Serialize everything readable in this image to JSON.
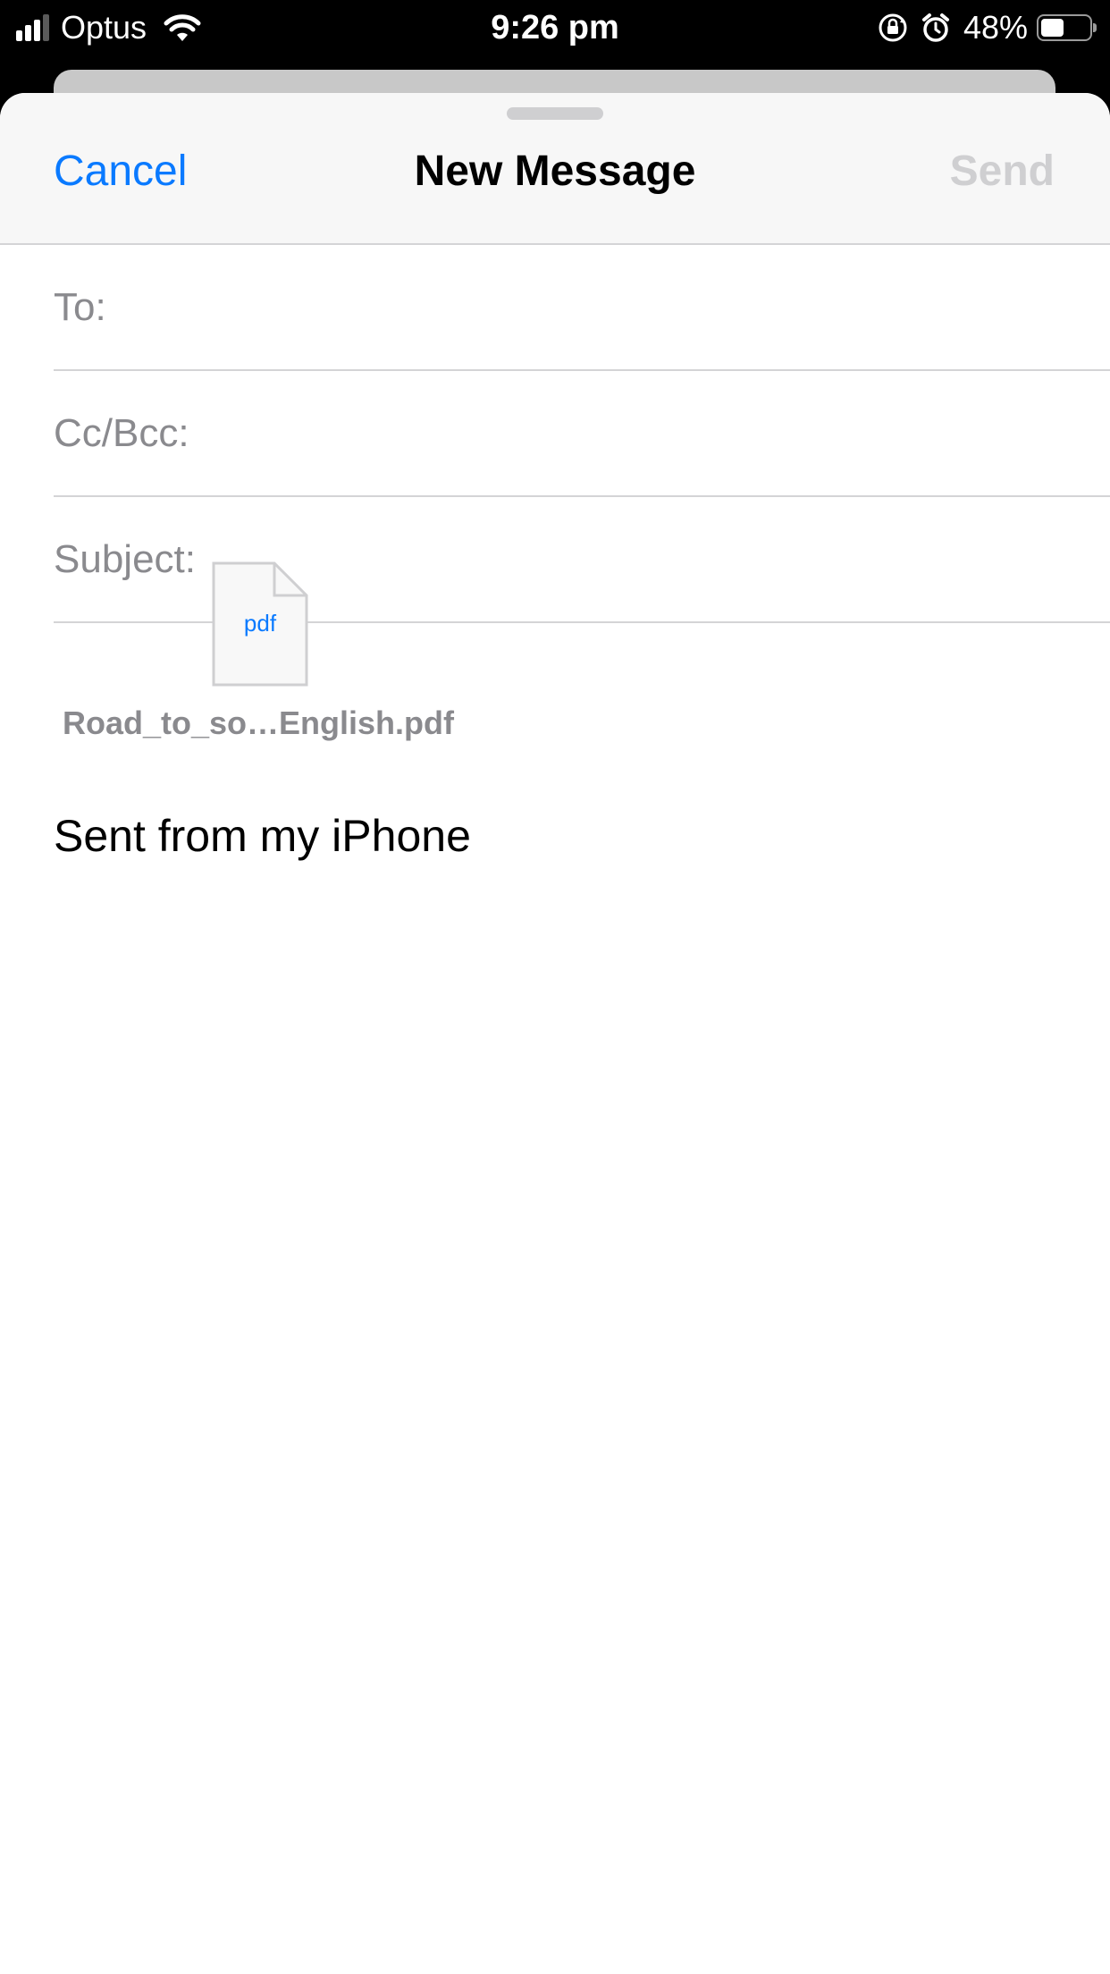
{
  "status_bar": {
    "carrier": "Optus",
    "time": "9:26 pm",
    "battery_percent_text": "48%",
    "battery_level": 0.48,
    "signal_bars_filled": 3,
    "signal_bars_total": 4,
    "icons": [
      "signal-icon",
      "wifi-icon",
      "rotation-lock-icon",
      "alarm-icon",
      "battery-icon"
    ]
  },
  "nav": {
    "cancel_label": "Cancel",
    "title": "New Message",
    "send_label": "Send"
  },
  "fields": {
    "to_label": "To:",
    "to_value": "",
    "cc_label": "Cc/Bcc:",
    "cc_value": "",
    "subject_label": "Subject:",
    "subject_value": ""
  },
  "attachment": {
    "icon_text": "pdf",
    "filename": "Road_to_so…English.pdf"
  },
  "body": {
    "signature": "Sent from my iPhone"
  },
  "colors": {
    "accent": "#0a7aff",
    "disabled": "#cfcfd1",
    "secondary_text": "#8a8a8e"
  }
}
